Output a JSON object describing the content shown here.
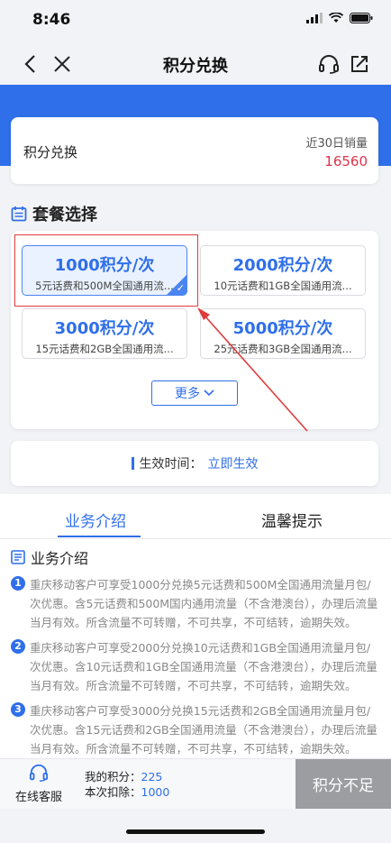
{
  "status_bar": {
    "time": "8:46"
  },
  "nav": {
    "title": "积分兑换"
  },
  "summary": {
    "title": "积分兑换",
    "sales_label": "近30日销量",
    "sales_value": "16560"
  },
  "packages_section": {
    "title": "套餐选择",
    "more_label": "更多"
  },
  "packages": [
    {
      "points": "1000积分/次",
      "desc": "5元话费和500M全国通用流...",
      "selected": true
    },
    {
      "points": "2000积分/次",
      "desc": "10元话费和1GB全国通用流...",
      "selected": false
    },
    {
      "points": "3000积分/次",
      "desc": "15元话费和2GB全国通用流...",
      "selected": false
    },
    {
      "points": "5000积分/次",
      "desc": "25元话费和3GB全国通用流...",
      "selected": false
    }
  ],
  "effective": {
    "label": "生效时间：",
    "value": "立即生效"
  },
  "tabs": [
    {
      "label": "业务介绍",
      "active": true
    },
    {
      "label": "温馨提示",
      "active": false
    }
  ],
  "intro": {
    "title": "业务介绍",
    "items": [
      {
        "num": "1",
        "text": "重庆移动客户可享受1000分兑换5元话费和500M全国通用流量月包/次优惠。含5元话费和500M国内通用流量（不含港澳台），办理后流量当月有效。所含流量不可转赠，不可共享，不可结转，逾期失效。"
      },
      {
        "num": "2",
        "text": "重庆移动客户可享受2000分兑换10元话费和1GB全国通用流量月包/次优惠。含10元话费和1GB全国通用流量（不含港澳台），办理后流量当月有效。所含流量不可转赠，不可共享，不可结转，逾期失效。"
      },
      {
        "num": "3",
        "text": "重庆移动客户可享受3000分兑换15元话费和2GB全国通用流量月包/次优惠。含15元话费和2GB全国通用流量（不含港澳台），办理后流量当月有效。所含流量不可转赠，不可共享，不可结转，逾期失效。"
      }
    ]
  },
  "bottom": {
    "service_label": "在线客服",
    "my_points_label": "我的积分：",
    "my_points_value": "225",
    "deduct_label": "本次扣除：",
    "deduct_value": "1000",
    "submit_label": "积分不足"
  },
  "colors": {
    "accent": "#2f6fea",
    "sales": "#e0344a",
    "disabled": "#9b9da1",
    "annotation": "#e03a3a"
  }
}
